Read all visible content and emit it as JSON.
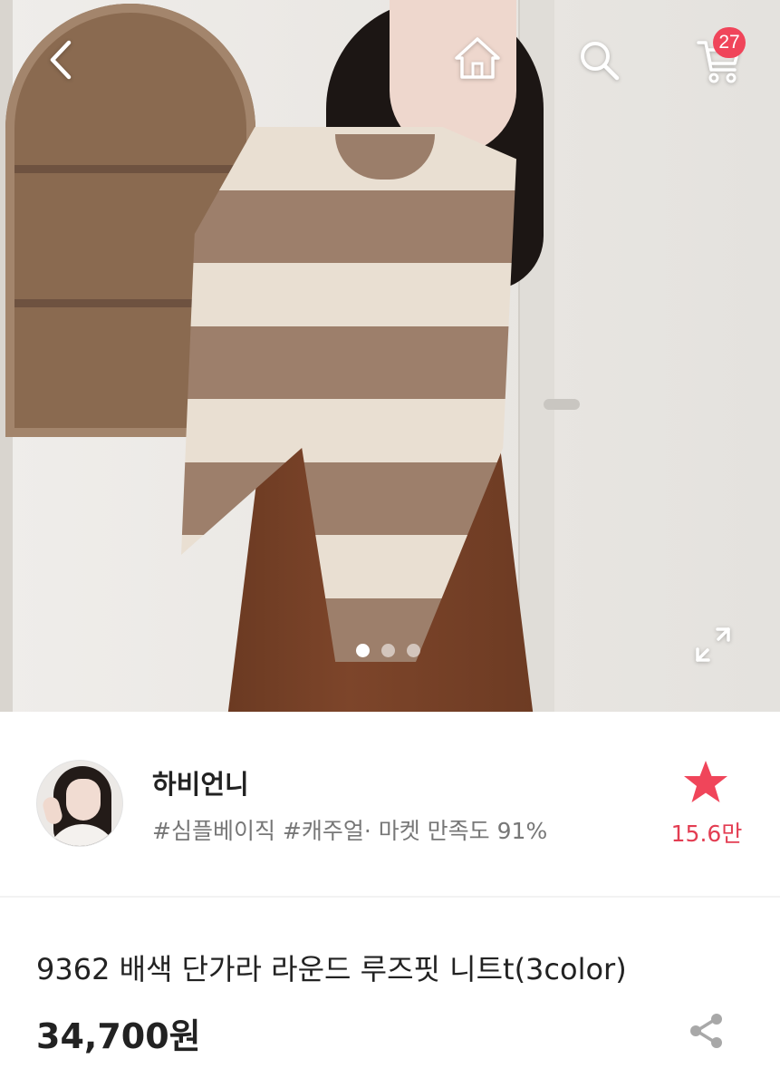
{
  "header": {
    "back_icon": "chevron-left-icon",
    "home_icon": "home-icon",
    "search_icon": "search-icon",
    "cart_icon": "cart-icon",
    "cart_badge": "27"
  },
  "gallery": {
    "page_count": 3,
    "active_index": 0,
    "expand_icon": "expand-icon"
  },
  "seller": {
    "name": "하비언니",
    "tags": "#심플베이직 #캐주얼· 마켓 만족도 91%",
    "favorite_count": "15.6만",
    "favorite_icon": "star-icon"
  },
  "product": {
    "name": "9362 배색 단가라 라운드 루즈핏 니트t(3color)",
    "price": "34,700원",
    "share_icon": "share-icon"
  },
  "colors": {
    "accent": "#f0455a",
    "star": "#f0455a",
    "favorite_text": "#e33d52"
  }
}
